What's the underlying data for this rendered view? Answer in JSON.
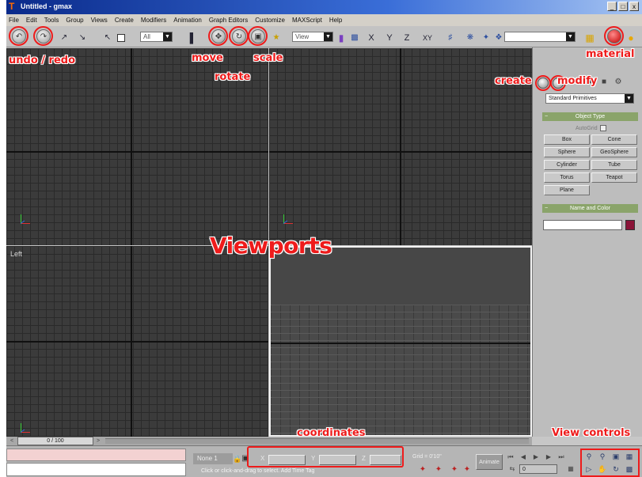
{
  "window": {
    "title": "Untitled - gmax",
    "controls": [
      "_",
      "□",
      "x"
    ]
  },
  "menu": [
    "File",
    "Edit",
    "Tools",
    "Group",
    "Views",
    "Create",
    "Modifiers",
    "Animation",
    "Graph Editors",
    "Customize",
    "MAXScript",
    "Help"
  ],
  "toolbar": {
    "selection_filter": "All",
    "coordinate_system": "View",
    "axis_constraints": [
      "X",
      "Y",
      "Z",
      "XY"
    ]
  },
  "viewports": {
    "left_label": "Left"
  },
  "command_panel": {
    "dropdown": "Standard Primitives",
    "object_type_header": "Object Type",
    "autogrid": "AutoGrid",
    "buttons": [
      "Box",
      "Cone",
      "Sphere",
      "GeoSphere",
      "Cylinder",
      "Tube",
      "Torus",
      "Teapot",
      "Plane"
    ],
    "name_color_header": "Name and Color",
    "object_color": "#8a1438"
  },
  "timeline": {
    "frame": "0 / 100"
  },
  "status": {
    "selection": "None 1",
    "coord_labels": [
      "X",
      "Y",
      "Z"
    ],
    "grid": "Grid = 0'10\"",
    "prompt": "Click or click-and-drag to select. Add Time Tag",
    "animate": "Animate",
    "frame_value": "0"
  },
  "annotations": {
    "undo_redo": "undo / redo",
    "move": "move",
    "rotate": "rotate",
    "scale": "scale",
    "material": "material",
    "create": "create",
    "modify": "modify",
    "viewports": "Viewports",
    "coordinates": "coordinates",
    "view_controls": "View controls"
  },
  "colors": {
    "highlight": "#ee1b1b",
    "viewport": "#3b3b3b",
    "rollout": "#8aa46a"
  }
}
